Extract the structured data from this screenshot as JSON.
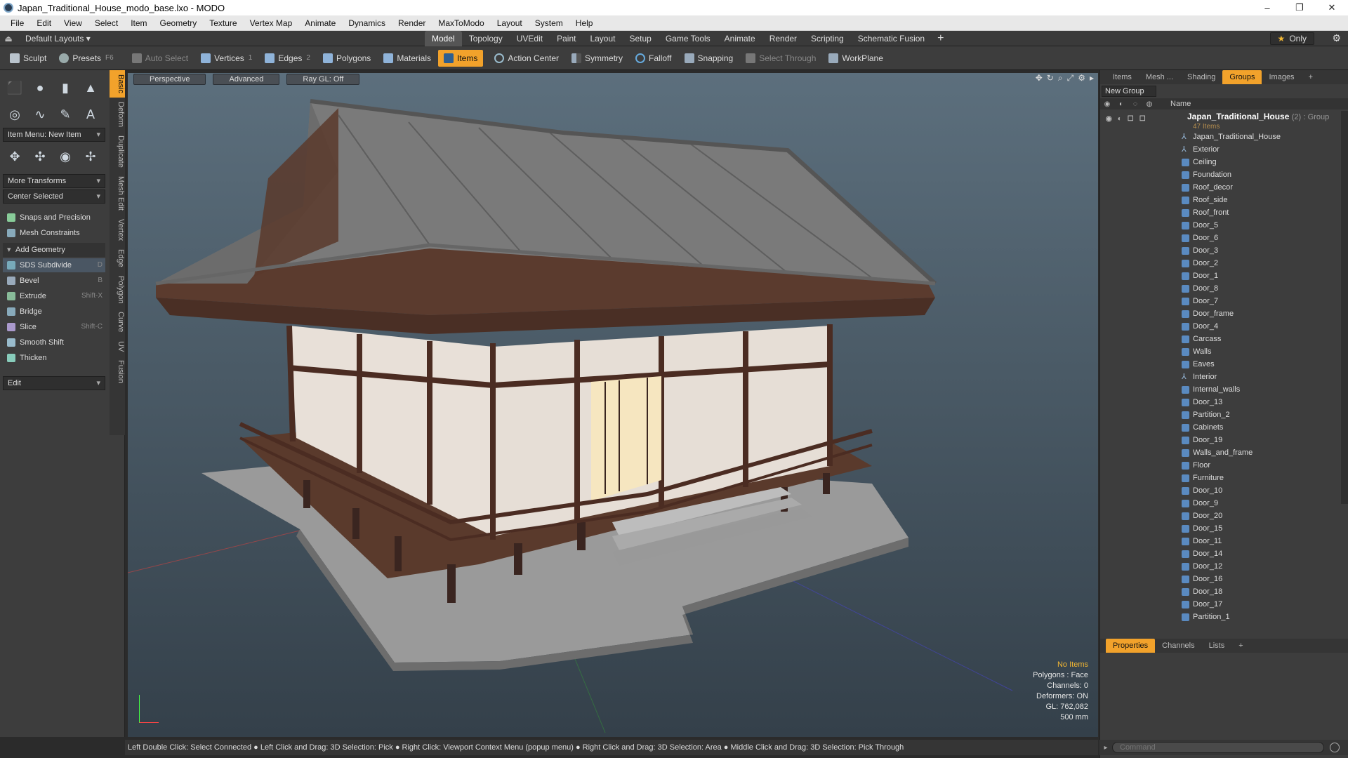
{
  "window": {
    "title": "Japan_Traditional_House_modo_base.lxo - MODO",
    "minimize": "–",
    "maximize": "❐",
    "close": "✕"
  },
  "menu": [
    "File",
    "Edit",
    "View",
    "Select",
    "Item",
    "Geometry",
    "Texture",
    "Vertex Map",
    "Animate",
    "Dynamics",
    "Render",
    "MaxToModo",
    "Layout",
    "System",
    "Help"
  ],
  "layout_bar": {
    "default_layouts": "Default Layouts ▾",
    "tabs": [
      "Model",
      "Topology",
      "UVEdit",
      "Paint",
      "Layout",
      "Setup",
      "Game Tools",
      "Animate",
      "Render",
      "Scripting",
      "Schematic Fusion"
    ],
    "active_tab": "Model",
    "plus": "+",
    "only": "Only"
  },
  "toolbar": {
    "sculpt": "Sculpt",
    "presets": "Presets",
    "presets_key": "F6",
    "auto_select": "Auto Select",
    "vertices": "Vertices",
    "vertices_key": "1",
    "edges": "Edges",
    "edges_key": "2",
    "polygons": "Polygons",
    "materials": "Materials",
    "items": "Items",
    "action_center": "Action Center",
    "symmetry": "Symmetry",
    "falloff": "Falloff",
    "snapping": "Snapping",
    "select_through": "Select Through",
    "workplane": "WorkPlane"
  },
  "left_panel": {
    "vertical_tabs": [
      "Basic",
      "Deform",
      "Duplicate",
      "Mesh Edit",
      "Vertex",
      "Edge",
      "Polygon",
      "Curve",
      "UV",
      "Fusion"
    ],
    "item_menu": "Item Menu: New Item",
    "more_transforms": "More Transforms",
    "center_selected": "Center Selected",
    "snaps": "Snaps and Precision",
    "mesh_constraints": "Mesh Constraints",
    "add_geometry": "Add Geometry",
    "tools": [
      {
        "label": "SDS Subdivide",
        "key": "D"
      },
      {
        "label": "Bevel",
        "key": "B"
      },
      {
        "label": "Extrude",
        "key": "Shift-X"
      },
      {
        "label": "Bridge",
        "key": ""
      },
      {
        "label": "Slice",
        "key": "Shift-C"
      },
      {
        "label": "Smooth Shift",
        "key": ""
      },
      {
        "label": "Thicken",
        "key": ""
      }
    ],
    "edit": "Edit"
  },
  "viewport": {
    "perspective": "Perspective",
    "advanced": "Advanced",
    "raygl": "Ray GL: Off",
    "stats": {
      "no_items": "No Items",
      "polygons": "Polygons : Face",
      "channels": "Channels: 0",
      "deformers": "Deformers: ON",
      "gl": "GL: 762,082",
      "scale": "500 mm"
    }
  },
  "status_bar": "Left Double Click: Select Connected ● Left Click and Drag: 3D Selection: Pick ● Right Click: Viewport Context Menu (popup menu) ● Right Click and Drag: 3D Selection: Area ● Middle Click and Drag: 3D Selection: Pick Through",
  "right_panel": {
    "tabs": [
      "Items",
      "Mesh ...",
      "Shading",
      "Groups",
      "Images"
    ],
    "active_tab": "Groups",
    "plus": "+",
    "new_group": "New Group",
    "name_header": "Name",
    "root": {
      "name": "Japan_Traditional_House",
      "count": "(2)",
      "type": ": Group",
      "sub": "47 Items"
    },
    "items": [
      "Japan_Traditional_House",
      "Exterior",
      "Ceiling",
      "Foundation",
      "Roof_decor",
      "Roof_side",
      "Roof_front",
      "Door_5",
      "Door_6",
      "Door_3",
      "Door_2",
      "Door_1",
      "Door_8",
      "Door_7",
      "Door_frame",
      "Door_4",
      "Carcass",
      "Walls",
      "Eaves",
      "Interior",
      "Internal_walls",
      "Door_13",
      "Partition_2",
      "Cabinets",
      "Door_19",
      "Walls_and_frame",
      "Floor",
      "Furniture",
      "Door_10",
      "Door_9",
      "Door_20",
      "Door_15",
      "Door_11",
      "Door_14",
      "Door_12",
      "Door_16",
      "Door_18",
      "Door_17",
      "Partition_1"
    ],
    "locator_items": [
      "Japan_Traditional_House",
      "Exterior",
      "Interior"
    ],
    "bottom_tabs": [
      "Properties",
      "Channels",
      "Lists"
    ],
    "bottom_active": "Properties"
  },
  "command": {
    "placeholder": "Command"
  }
}
